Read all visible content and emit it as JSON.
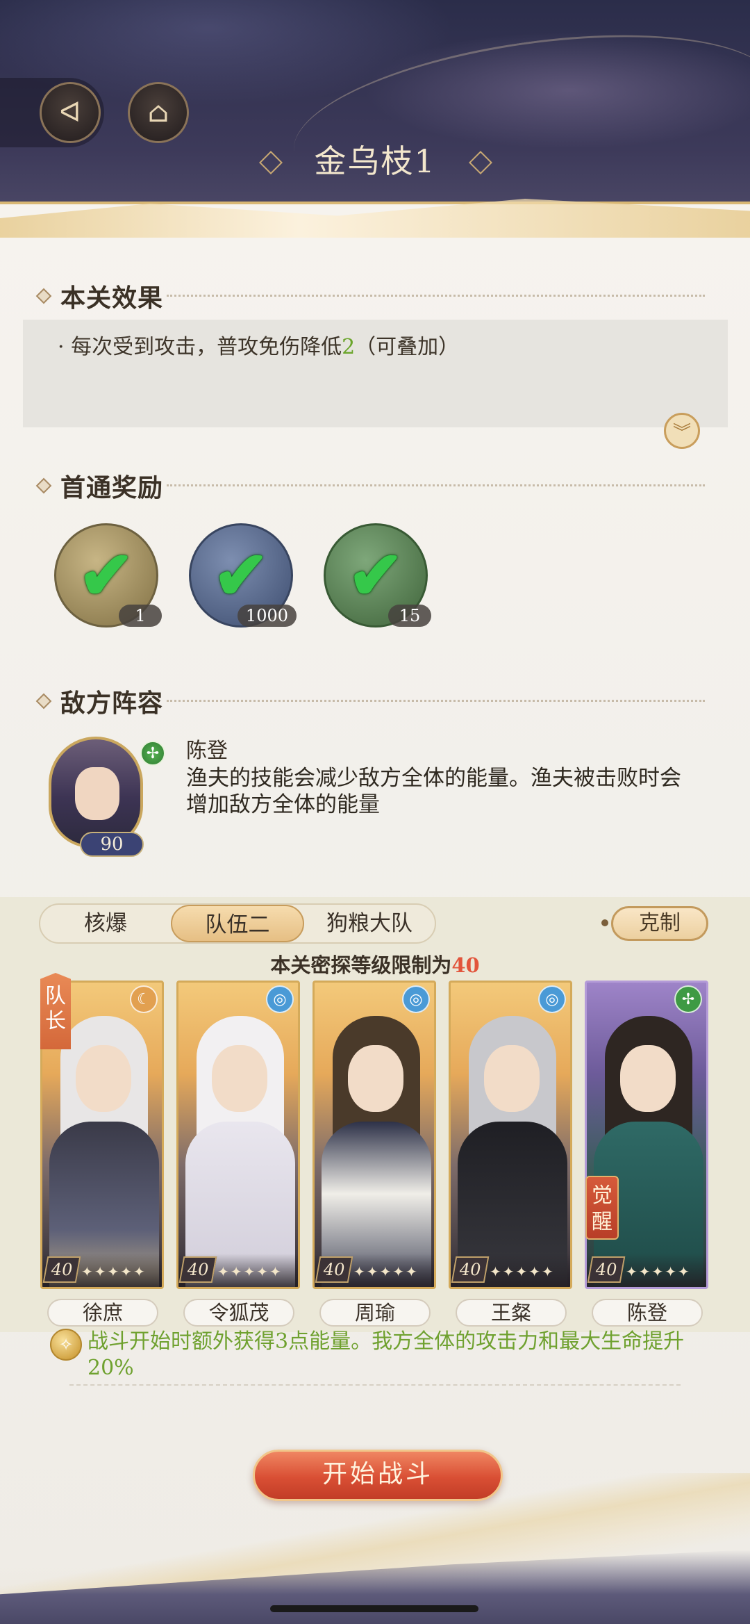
{
  "header": {
    "title": "金乌枝1",
    "back_icon": "back-arrow-icon",
    "home_icon": "pavilion-icon"
  },
  "effect": {
    "heading": "本关效果",
    "text_prefix": "· 每次受到攻击，普攻免伤降低",
    "text_num": "2",
    "text_suffix": "（可叠加）",
    "expand_icon": "chevron-double-down-icon"
  },
  "rewards": {
    "heading": "首通奖励",
    "items": [
      {
        "count": "1",
        "claimed": true
      },
      {
        "count": "1000",
        "claimed": true
      },
      {
        "count": "15",
        "claimed": true
      }
    ]
  },
  "enemy": {
    "heading": "敌方阵容",
    "name": "陈登",
    "level": "90",
    "description": "渔夫的技能会减少敌方全体的能量。渔夫被击败时会增加敌方全体的能量",
    "element_icon": "leaf-element-icon"
  },
  "team": {
    "tabs": [
      "核爆",
      "队伍二",
      "狗粮大队"
    ],
    "active_tab": 1,
    "counter_label": "克制",
    "limit_prefix": "本关密探等级限制为",
    "limit_value": "40",
    "leader_label": "队长",
    "awaken_label": "觉醒",
    "members": [
      {
        "name": "徐庶",
        "level": "40",
        "stars": "✦✦✦✦✦",
        "element": "moon-element-icon"
      },
      {
        "name": "令狐茂",
        "level": "40",
        "stars": "✦✦✦✦✦",
        "element": "swirl-element-icon"
      },
      {
        "name": "周瑜",
        "level": "40",
        "stars": "✦✦✦✦✦",
        "element": "swirl-element-icon"
      },
      {
        "name": "王粲",
        "level": "40",
        "stars": "✦✦✦✦✦",
        "element": "swirl-element-icon"
      },
      {
        "name": "陈登",
        "level": "40",
        "stars": "✦✦✦✦✦",
        "element": "leaf-element-icon"
      }
    ],
    "skill_text": "战斗开始时额外获得3点能量。我方全体的攻击力和最大生命提升20%"
  },
  "start_button": "开始战斗",
  "colors": {
    "accent_gold": "#d4aa5a",
    "effect_number": "#6aa52a",
    "limit_number": "#e2553c",
    "start_button": "#d94f34",
    "skill_text": "#6fa12f"
  }
}
